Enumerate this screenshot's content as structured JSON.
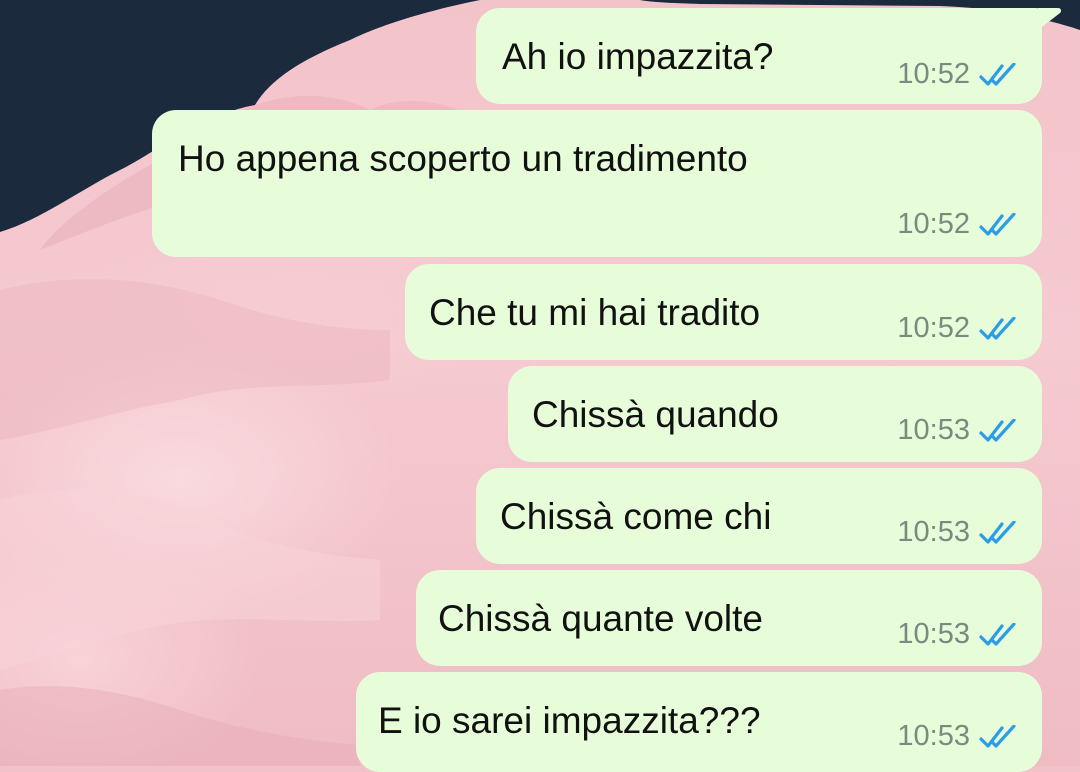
{
  "chat": {
    "messages": [
      {
        "text": "Ah io impazzita?",
        "time": "10:52",
        "status_icon": "double-check-read-icon"
      },
      {
        "text": "Ho appena scoperto un tradimento",
        "time": "10:52",
        "status_icon": "double-check-read-icon"
      },
      {
        "text": "Che tu mi hai tradito",
        "time": "10:52",
        "status_icon": "double-check-read-icon"
      },
      {
        "text": "Chissà quando",
        "time": "10:53",
        "status_icon": "double-check-read-icon"
      },
      {
        "text": "Chissà come chi",
        "time": "10:53",
        "status_icon": "double-check-read-icon"
      },
      {
        "text": "Chissà quante volte",
        "time": "10:53",
        "status_icon": "double-check-read-icon"
      },
      {
        "text": "E io sarei impazzita???",
        "time": "10:53",
        "status_icon": "double-check-read-icon"
      }
    ]
  },
  "colors": {
    "bubble": "#e7fcd9",
    "read_ticks": "#2b9ce6",
    "wallpaper_sky": "#1b2a3c",
    "wallpaper_cloud": "#f2c2c9"
  }
}
